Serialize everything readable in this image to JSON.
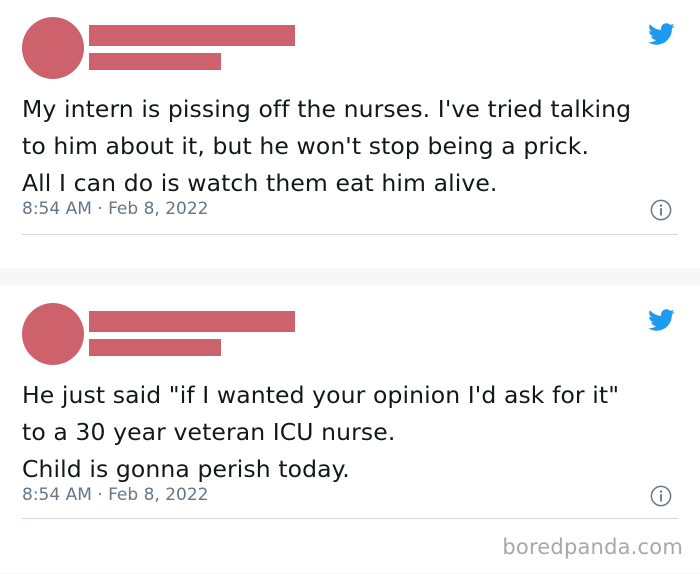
{
  "tweets": [
    {
      "text": "My intern is pissing off the nurses. I've tried talking\nto him about it, but he won't stop being a prick.\nAll I can do is watch them eat him alive.",
      "timestamp": "8:54 AM · Feb 8, 2022",
      "icon": "twitter-bird-icon",
      "info_icon": "info-icon"
    },
    {
      "text": "He just said \"if I wanted your opinion I'd ask for it\"\nto a 30 year veteran ICU nurse.\nChild is gonna perish today.",
      "timestamp": "8:54 AM · Feb 8, 2022",
      "icon": "twitter-bird-icon",
      "info_icon": "info-icon"
    }
  ],
  "watermark": "boredpanda.com",
  "colors": {
    "redacted": "#cd626c",
    "twitter_blue": "#1d9bf0",
    "text": "#14171a",
    "muted": "#657786",
    "background": "#f7f7f7",
    "card": "#ffffff"
  }
}
